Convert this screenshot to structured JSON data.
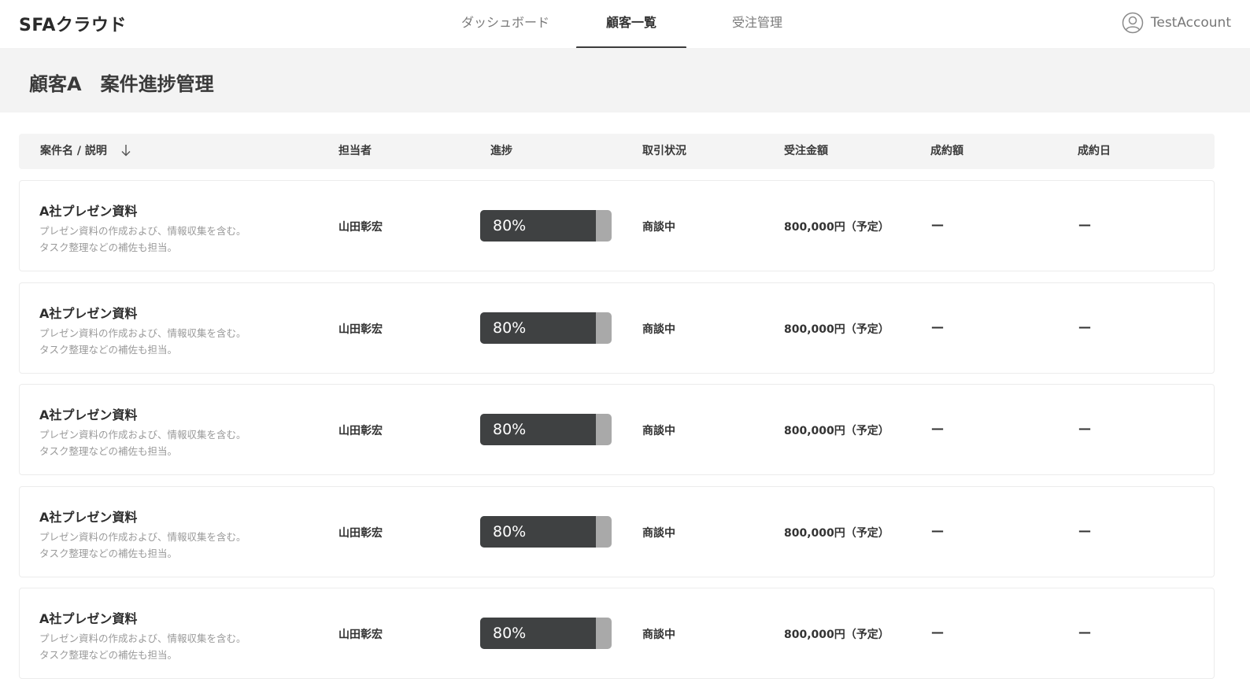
{
  "app": {
    "title": "SFAクラウド"
  },
  "nav": {
    "tabs": [
      {
        "label": "ダッシュボード",
        "active": false
      },
      {
        "label": "顧客一覧",
        "active": true
      },
      {
        "label": "受注管理",
        "active": false
      }
    ]
  },
  "account": {
    "name": "TestAccount",
    "icon": "user-circle-icon"
  },
  "page": {
    "title": "顧客A　案件進捗管理"
  },
  "table": {
    "columns": [
      {
        "key": "name",
        "label": "案件名 / 説明",
        "sort_icon": "arrow-down-icon"
      },
      {
        "key": "person",
        "label": "担当者"
      },
      {
        "key": "progress",
        "label": "進捗"
      },
      {
        "key": "status",
        "label": "取引状況"
      },
      {
        "key": "amount",
        "label": "受注金額"
      },
      {
        "key": "deal",
        "label": "成約額"
      },
      {
        "key": "date",
        "label": "成約日"
      }
    ],
    "rows": [
      {
        "title": "A社プレゼン資料",
        "desc1": "プレゼン資料の作成および、情報収集を含む。",
        "desc2": "タスク整理などの補佐も担当。",
        "person": "山田彰宏",
        "progress": 0.88,
        "progress_label": "80%",
        "status": "商談中",
        "amount": "800,000円（予定）",
        "deal": "—",
        "date": "—"
      },
      {
        "title": "A社プレゼン資料",
        "desc1": "プレゼン資料の作成および、情報収集を含む。",
        "desc2": "タスク整理などの補佐も担当。",
        "person": "山田彰宏",
        "progress": 0.88,
        "progress_label": "80%",
        "status": "商談中",
        "amount": "800,000円（予定）",
        "deal": "—",
        "date": "—"
      },
      {
        "title": "A社プレゼン資料",
        "desc1": "プレゼン資料の作成および、情報収集を含む。",
        "desc2": "タスク整理などの補佐も担当。",
        "person": "山田彰宏",
        "progress": 0.88,
        "progress_label": "80%",
        "status": "商談中",
        "amount": "800,000円（予定）",
        "deal": "—",
        "date": "—"
      },
      {
        "title": "A社プレゼン資料",
        "desc1": "プレゼン資料の作成および、情報収集を含む。",
        "desc2": "タスク整理などの補佐も担当。",
        "person": "山田彰宏",
        "progress": 0.88,
        "progress_label": "80%",
        "status": "商談中",
        "amount": "800,000円（予定）",
        "deal": "—",
        "date": "—"
      },
      {
        "title": "A社プレゼン資料",
        "desc1": "プレゼン資料の作成および、情報収集を含む。",
        "desc2": "タスク整理などの補佐も担当。",
        "person": "山田彰宏",
        "progress": 0.88,
        "progress_label": "80%",
        "status": "商談中",
        "amount": "800,000円（予定）",
        "deal": "—",
        "date": "—"
      }
    ]
  },
  "colors": {
    "progress_fill": "#3f4142",
    "progress_track": "#a9a9a9",
    "header_band": "#f3f3f3",
    "active_tab_underline": "#3c3c3c"
  }
}
